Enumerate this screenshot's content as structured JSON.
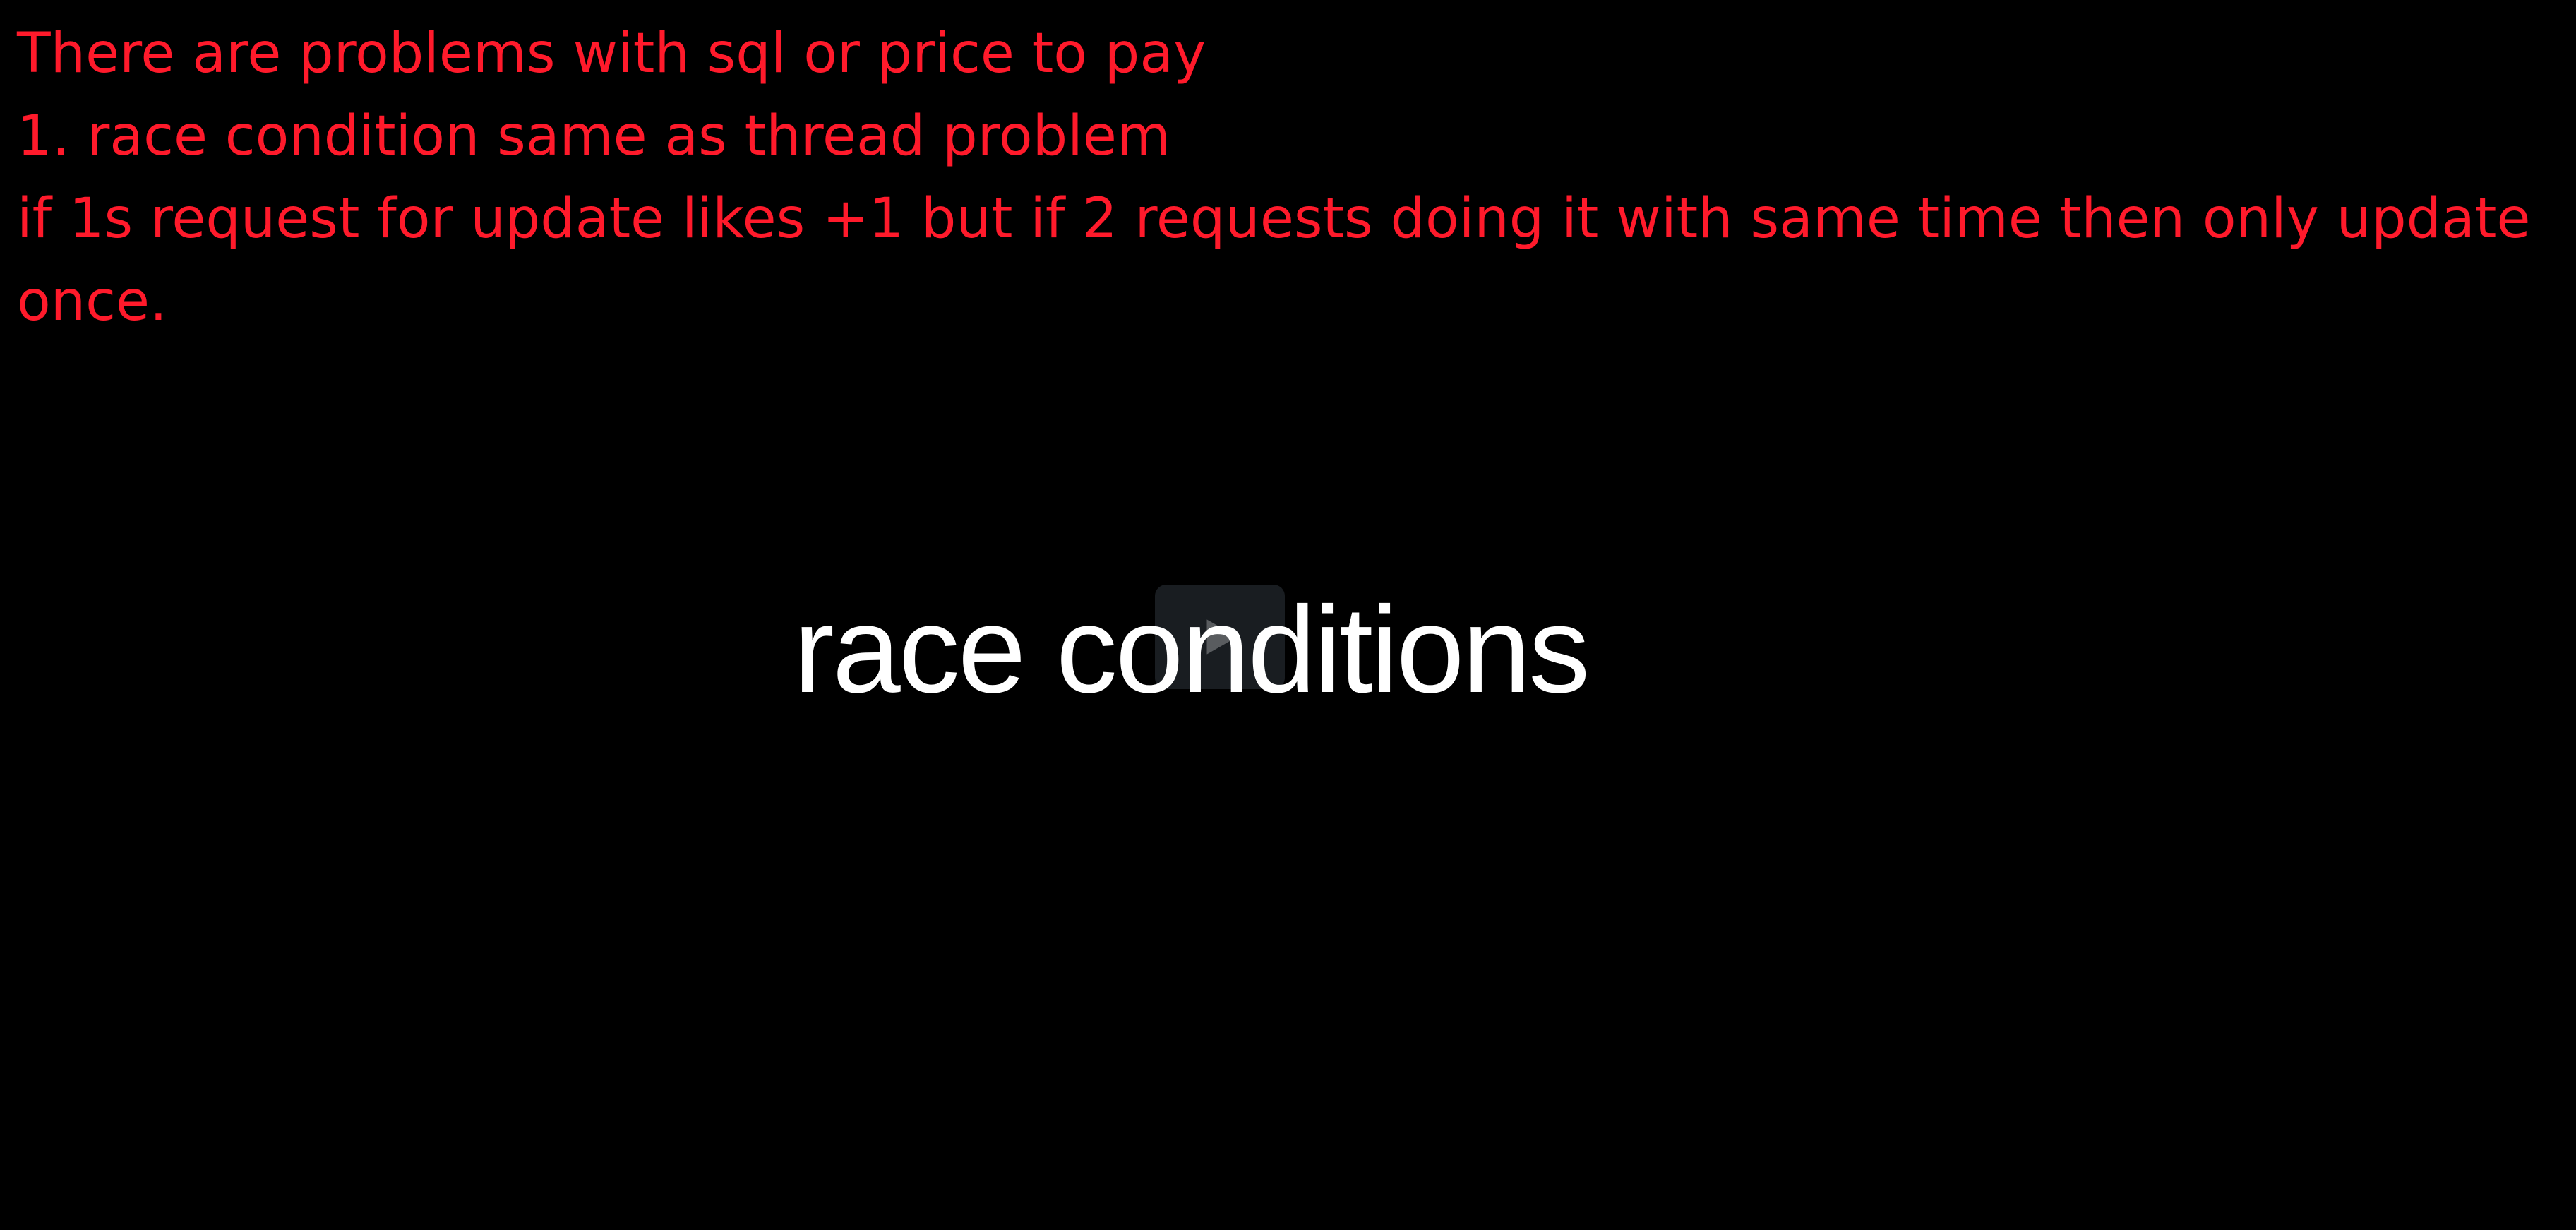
{
  "notes": {
    "lines": [
      "There are problems with sql or price to pay",
      "1. race condition same as thread problem",
      "if 1s request for update likes +1 but if 2 requests doing it with same time then only update once."
    ],
    "color": "#ff1a2b"
  },
  "video": {
    "caption": "race conditions",
    "play_icon": "play-icon"
  },
  "colors": {
    "background": "#000000",
    "caption": "#ffffff"
  }
}
